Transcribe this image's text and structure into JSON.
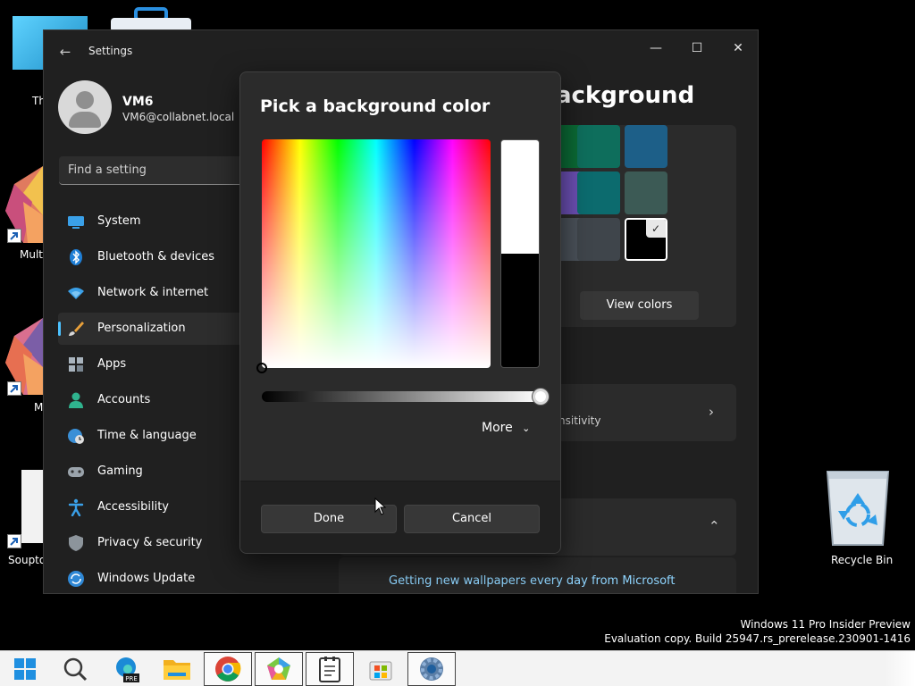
{
  "desktop": {
    "icons": [
      {
        "label": "Th"
      },
      {
        "label": "Mult"
      },
      {
        "label": "M"
      },
      {
        "label": "Souptо"
      },
      {
        "label": "Recycle Bin"
      }
    ],
    "watermark": {
      "line1": "Windows 11 Pro Insider Preview",
      "line2": "Evaluation copy. Build 25947.rs_prerelease.230901-1416"
    }
  },
  "window": {
    "title": "Settings",
    "back_icon": "arrow-left-icon",
    "controls": {
      "minimize": "—",
      "maximize": "☐",
      "close": "✕"
    }
  },
  "profile": {
    "name": "VM6",
    "email": "VM6@collabnet.local"
  },
  "search": {
    "placeholder": "Find a setting"
  },
  "nav": {
    "items": [
      {
        "label": "System",
        "icon": "system-icon"
      },
      {
        "label": "Bluetooth & devices",
        "icon": "bluetooth-icon"
      },
      {
        "label": "Network & internet",
        "icon": "wifi-icon"
      },
      {
        "label": "Personalization",
        "icon": "brush-icon",
        "active": true
      },
      {
        "label": "Apps",
        "icon": "apps-icon"
      },
      {
        "label": "Accounts",
        "icon": "person-icon"
      },
      {
        "label": "Time & language",
        "icon": "globe-clock-icon"
      },
      {
        "label": "Gaming",
        "icon": "gamepad-icon"
      },
      {
        "label": "Accessibility",
        "icon": "accessibility-icon"
      },
      {
        "label": "Privacy & security",
        "icon": "shield-icon"
      },
      {
        "label": "Windows Update",
        "icon": "update-icon"
      }
    ]
  },
  "content": {
    "title_fragment": "ackground",
    "swatch_colors": [
      "#0b6a35",
      "#0e6e5c",
      "#1d5f88",
      "#6b4fb3",
      "#0c6b6e",
      "#3c5a55",
      "#4a5159",
      "#3f454b",
      "#000000"
    ],
    "selected_swatch": "#000000",
    "view_colors_label": "View colors",
    "contrast_text_fragment": "nsitivity",
    "wallpaper_link": "Getting new wallpapers every day from Microsoft"
  },
  "dialog": {
    "title": "Pick a background color",
    "selected_color": "#000000",
    "previous_color": "#ffffff",
    "value_level_percent": 100,
    "more_label": "More",
    "done_label": "Done",
    "cancel_label": "Cancel"
  },
  "taskbar": {
    "apps": [
      "start-icon",
      "search-icon",
      "edge-pre-icon",
      "file-explorer-icon",
      "chrome-icon",
      "copilot-icon",
      "notepad-icon",
      "store-icon",
      "settings-icon"
    ]
  }
}
